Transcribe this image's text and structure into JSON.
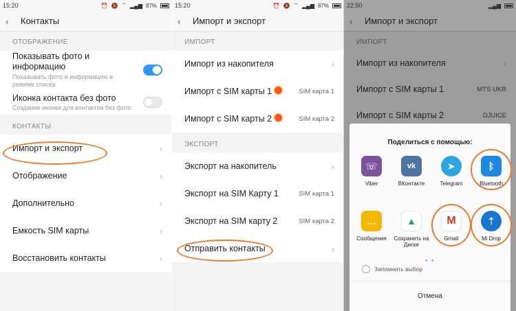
{
  "panel1": {
    "status": {
      "time": "15:20",
      "battery": "87%"
    },
    "title": "Контакты",
    "section_display": "ОТОБРАЖЕНИЕ",
    "show_photo": {
      "label": "Показывать фото и информацию",
      "sub": "Показывать фото и информацию в режиме списка",
      "on": true
    },
    "contact_icon": {
      "label": "Иконка контакта без фото",
      "sub": "Создание иконки для контактов без фото",
      "on": false
    },
    "section_contacts": "КОНТАКТЫ",
    "items": [
      {
        "label": "Импорт и экспорт"
      },
      {
        "label": "Отображение"
      },
      {
        "label": "Дополнительно"
      },
      {
        "label": "Емкость SIM карты"
      },
      {
        "label": "Восстановить контакты"
      }
    ]
  },
  "panel2": {
    "status": {
      "time": "15:20",
      "battery": "87%"
    },
    "title": "Импорт и экспорт",
    "section_import": "ИМПОРТ",
    "import_items": [
      {
        "label": "Импорт из накопителя",
        "value": ""
      },
      {
        "label": "Импорт с SIM карты 1",
        "value": "SIM карта 1"
      },
      {
        "label": "Импорт с SIM карты 2",
        "value": "SIM карта 2"
      }
    ],
    "section_export": "ЭКСПОРТ",
    "export_items": [
      {
        "label": "Экспорт на накопитель",
        "value": ""
      },
      {
        "label": "Экспорт на SIM Карту 1",
        "value": "SIM карта 1"
      },
      {
        "label": "Экспорт на SIM карту 2",
        "value": "SIM карта 2"
      },
      {
        "label": "Отправить контакты",
        "value": ""
      }
    ]
  },
  "panel3": {
    "status": {
      "time": "22:50"
    },
    "title": "Импорт и экспорт",
    "section_import": "ИМПОРТ",
    "items": [
      {
        "label": "Импорт из накопителя",
        "value": ""
      },
      {
        "label": "Импорт с SIM карты 1",
        "value": "MTS UKR"
      },
      {
        "label": "Импорт с SIM карты 2",
        "value": "DJUICE"
      }
    ],
    "sheet": {
      "title": "Поделиться с помощью:",
      "apps": [
        {
          "label": "Viber",
          "color": "#7b519d",
          "glyph": "☏"
        },
        {
          "label": "ВКонтакте",
          "color": "#4c75a3",
          "glyph": "vk"
        },
        {
          "label": "Telegram",
          "color": "#2ca5e0",
          "glyph": "➤"
        },
        {
          "label": "Bluetooth",
          "color": "#1e88e5",
          "glyph": "ᛒ"
        },
        {
          "label": "Сообщения",
          "color": "#f5b800",
          "glyph": "…"
        },
        {
          "label": "Сохранить на Диске",
          "color": "#ffffff",
          "glyph": "▲"
        },
        {
          "label": "Gmail",
          "color": "#ffffff",
          "glyph": "M"
        },
        {
          "label": "Mi Drop",
          "color": "#1976d2",
          "glyph": "⇡"
        }
      ],
      "pager": "• •",
      "remember_label": "Запомнить выбор",
      "cancel_label": "Отмена"
    }
  },
  "colors": {
    "accent": "#2f9af3",
    "highlight": "#f07b2c"
  }
}
